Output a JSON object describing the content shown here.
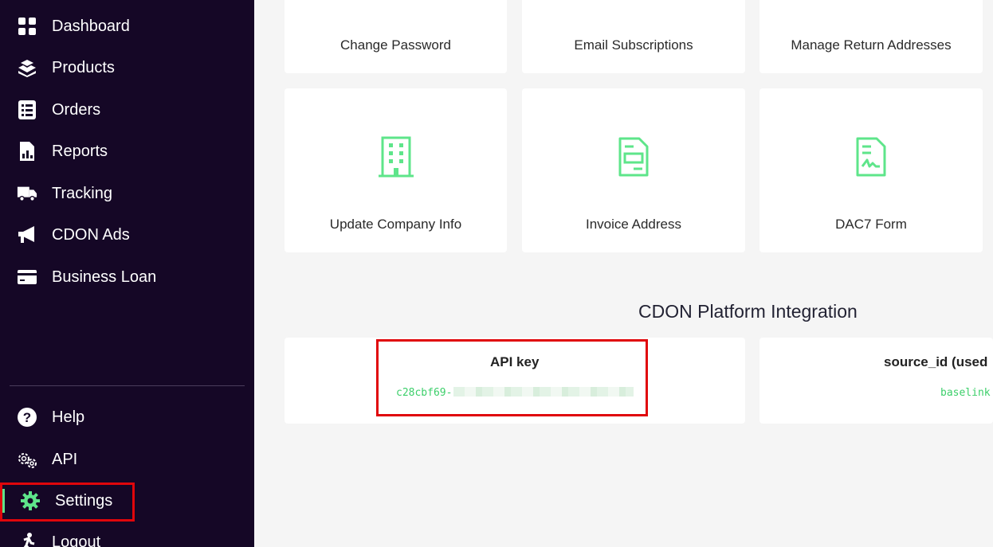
{
  "sidebar": {
    "items": [
      {
        "label": "Dashboard",
        "icon": "grid-icon"
      },
      {
        "label": "Products",
        "icon": "box-stack-icon"
      },
      {
        "label": "Orders",
        "icon": "checklist-icon"
      },
      {
        "label": "Reports",
        "icon": "report-chart-icon"
      },
      {
        "label": "Tracking",
        "icon": "truck-icon"
      },
      {
        "label": "CDON Ads",
        "icon": "megaphone-icon"
      },
      {
        "label": "Business Loan",
        "icon": "credit-card-icon"
      }
    ],
    "bottom_items": [
      {
        "label": "Help",
        "icon": "help-circle-icon"
      },
      {
        "label": "API",
        "icon": "gears-icon"
      },
      {
        "label": "Settings",
        "icon": "gear-icon"
      },
      {
        "label": "Logout",
        "icon": "running-person-icon"
      }
    ],
    "active_color": "#5ee58a"
  },
  "main": {
    "cards_top": [
      {
        "label": "Change Password"
      },
      {
        "label": "Email Subscriptions"
      },
      {
        "label": "Manage Return Addresses"
      }
    ],
    "cards_mid": [
      {
        "label": "Update Company Info",
        "icon": "building-icon"
      },
      {
        "label": "Invoice Address",
        "icon": "invoice-document-icon"
      },
      {
        "label": "DAC7 Form",
        "icon": "signed-document-icon"
      }
    ],
    "section_title": "CDON Platform Integration",
    "api_key": {
      "label": "API key",
      "value": "c28cbf69-"
    },
    "source_id": {
      "label": "source_id (used",
      "value": "baselink"
    },
    "accent_color": "#5ee58a"
  }
}
